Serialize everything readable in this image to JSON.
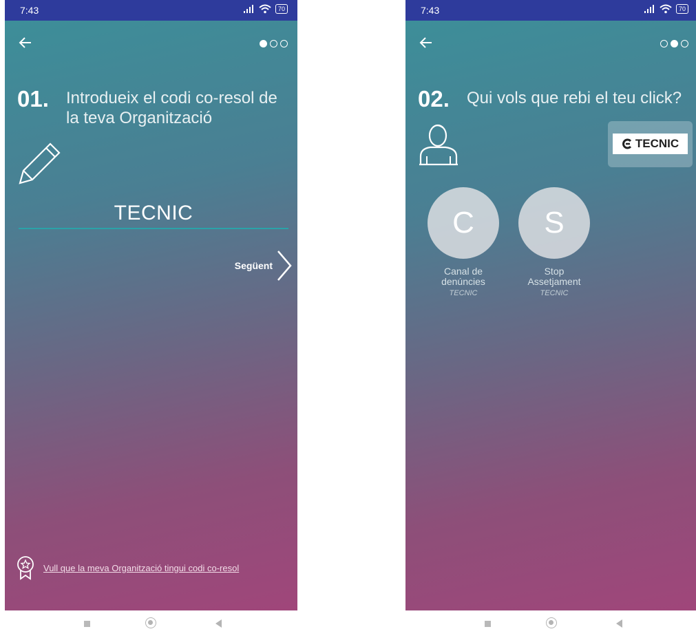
{
  "status_bar": {
    "time": "7:43",
    "battery": "70"
  },
  "screen1": {
    "pager": [
      true,
      false,
      false
    ],
    "step_number": "01.",
    "step_text": "Introdueix el codi co-resol de la teva Organització",
    "code_value": "TECNIC",
    "next_label": "Següent",
    "footer_link": "Vull que la meva Organització tingui codi co-resol"
  },
  "screen2": {
    "pager": [
      false,
      true,
      false
    ],
    "step_number": "02.",
    "step_text": "Qui vols que rebi el teu click?",
    "logo_text": "TECNIC",
    "channels": [
      {
        "initial": "C",
        "name": "Canal de denúncies",
        "org": "TECNIC"
      },
      {
        "initial": "S",
        "name": "Stop Assetjament",
        "org": "TECNIC"
      }
    ]
  },
  "colors": {
    "status_bar": "#2e3b9c",
    "gradient_top": "#3d8e99",
    "gradient_bottom": "#a0467a",
    "accent_line": "#2aa3a9"
  },
  "icons": [
    "back-arrow-icon",
    "pencil-icon",
    "chevron-right-icon",
    "badge-star-icon",
    "person-icon",
    "wifi-icon",
    "signal-icon"
  ]
}
